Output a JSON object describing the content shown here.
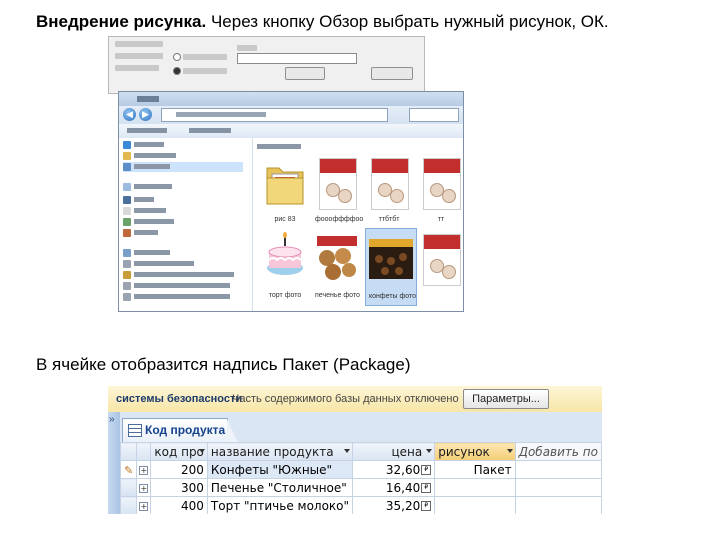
{
  "caption_top": {
    "bold": "Внедрение рисунка.",
    "rest": " Через кнопку Обзор выбрать нужный рисунок, ОК."
  },
  "caption_bottom": "В ячейке отобразится надпись Пакет (Package)",
  "explorer": {
    "thumbnails": [
      {
        "label": "рис 83",
        "icon": "folder-icon"
      },
      {
        "label": "фоооффффоо",
        "icon": "candy-box-image"
      },
      {
        "label": "ттбтбт",
        "icon": "candy-box-image"
      },
      {
        "label": "тт",
        "icon": "candy-box-image"
      },
      {
        "label": "торт фото",
        "icon": "cake-image"
      },
      {
        "label": "печенье фото",
        "icon": "cookies-image"
      },
      {
        "label": "конфеты фото",
        "icon": "chocolates-image"
      },
      {
        "label": "",
        "icon": "candy-box-image"
      }
    ]
  },
  "access": {
    "message_bar": {
      "title": "системы безопасности",
      "text": "Часть содержимого базы данных отключено",
      "button": "Параметры..."
    },
    "tab_label": "Код продукта",
    "columns": [
      "код про",
      "название продукта",
      "цена",
      "рисунок",
      "Добавить по"
    ],
    "rows": [
      {
        "code": "200",
        "name": "Конфеты \"Южные\"",
        "price": "32,60",
        "picture": "Пакет"
      },
      {
        "code": "300",
        "name": "Печенье \"Столичное\"",
        "price": "16,40",
        "picture": ""
      },
      {
        "code": "400",
        "name": "Торт \"птичье молоко\"",
        "price": "35,20",
        "picture": ""
      }
    ],
    "colors": {
      "accent": "#15428b",
      "message_bar": "#f7e6a7",
      "selected_header": "#f5cd76"
    }
  }
}
